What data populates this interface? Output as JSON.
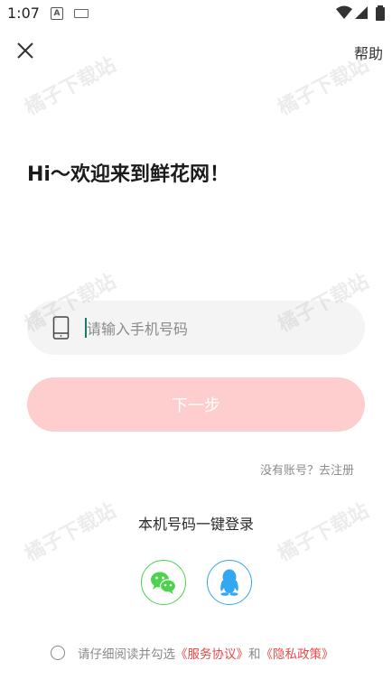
{
  "status_bar": {
    "time": "1:07",
    "notif_letter": "A"
  },
  "header": {
    "help_label": "帮助"
  },
  "welcome": {
    "title": "Hi～欢迎来到鲜花网！"
  },
  "phone": {
    "placeholder": "请输入手机号码",
    "value": ""
  },
  "buttons": {
    "next_label": "下一步"
  },
  "links": {
    "register": "没有账号？去注册"
  },
  "one_click_login": {
    "label": "本机号码一键登录"
  },
  "agreement": {
    "prefix": "请仔细阅读并勾选",
    "service": "《服务协议》",
    "and": "和",
    "privacy": "《隐私政策》"
  },
  "watermark": {
    "text": "橘子下载站"
  },
  "colors": {
    "primary_disabled": "#fecece",
    "link_red": "#e84a4a",
    "wechat": "#4cd24c",
    "qq": "#33a7f2"
  }
}
